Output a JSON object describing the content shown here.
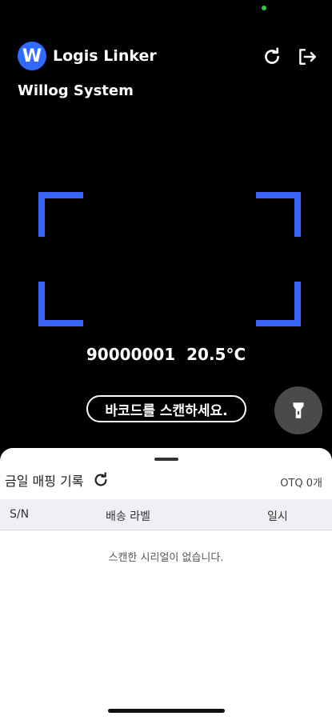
{
  "header": {
    "app_name": "Logis Linker",
    "logo_letter": "W",
    "system_name": "Willog System",
    "refresh_icon": "refresh-icon",
    "logout_icon": "logout-icon"
  },
  "scanner": {
    "reading": "90000001  20.5°C",
    "hint": "바코드를 스캔하세요.",
    "accent_color": "#3b66f5",
    "flash_icon": "flashlight-icon"
  },
  "sheet": {
    "title": "금일 매핑 기록",
    "qty": "OTQ 0개",
    "columns": [
      "S/N",
      "배송 라벨",
      "일시"
    ],
    "empty_message": "스캔한 시리얼이 없습니다."
  }
}
